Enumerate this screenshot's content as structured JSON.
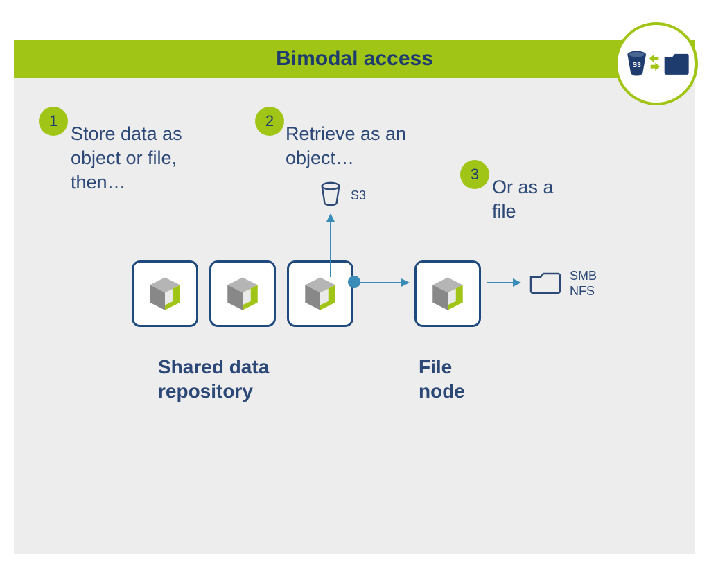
{
  "title": "Bimodal access",
  "steps": {
    "s1": {
      "num": "1",
      "text": "Store data as object or file, then…"
    },
    "s2": {
      "num": "2",
      "text": "Retrieve as an object…"
    },
    "s3": {
      "num": "3",
      "text": "Or as a file"
    }
  },
  "labels": {
    "shared_repo": "Shared data repository",
    "file_node": "File node",
    "s3": "S3",
    "smb_nfs": "SMB\nNFS"
  },
  "badge": {
    "bucket_label": "S3"
  }
}
